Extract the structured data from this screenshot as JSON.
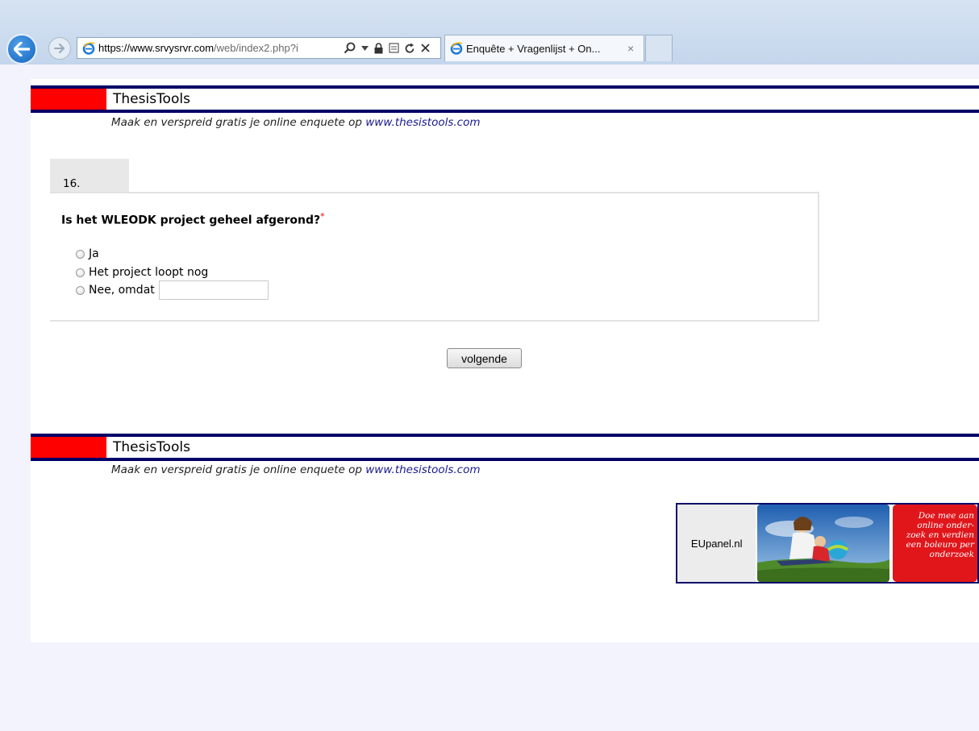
{
  "browser": {
    "url_host": "https://www.srvysrvr.com",
    "url_rest": "/web/index2.php?i",
    "tab_title": "Enquête + Vragenlijst + On...",
    "tab_close": "×"
  },
  "header": {
    "brand": "ThesisTools",
    "tagline": "Maak en verspreid gratis je online enquete op ",
    "tagline_link": "www.thesistools.com"
  },
  "question": {
    "number": "16.",
    "text": "Is het WLEODK project geheel afgerond?",
    "required_marker": "*",
    "options": [
      {
        "label": "Ja"
      },
      {
        "label": "Het project loopt nog"
      },
      {
        "label": "Nee, omdat"
      }
    ],
    "reason_value": ""
  },
  "navigation": {
    "next_label": "volgende"
  },
  "footer": {
    "brand": "ThesisTools",
    "tagline": "Maak en verspreid gratis je online enquete op ",
    "tagline_link": "www.thesistools.com"
  },
  "ad": {
    "label": "EUpanel.nl",
    "promo_lines": [
      "Doe mee aan",
      "online onder-",
      "zoek en verdien",
      "een boleuro per",
      "onderzoek"
    ]
  },
  "colors": {
    "brand_navy": "#000066",
    "brand_red": "#ff0000",
    "required_red": "#ee0000",
    "promo_red": "#e0161b"
  }
}
